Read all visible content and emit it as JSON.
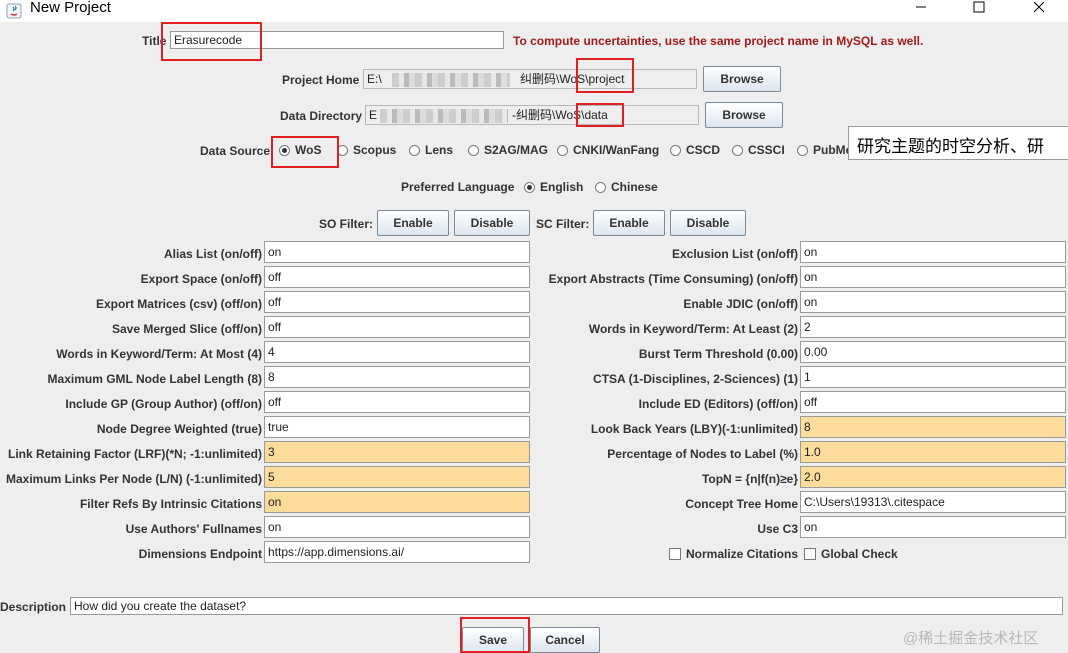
{
  "window": {
    "title": "New Project"
  },
  "title_row": {
    "label": "Title",
    "value": "Erasurecode",
    "note": "To compute uncertainties, use the same project name in MySQL as well."
  },
  "project_home": {
    "label": "Project Home",
    "prefix": "E:\\",
    "suffix": "纠删码\\WoS\\project",
    "browse": "Browse"
  },
  "data_directory": {
    "label": "Data Directory",
    "prefix": "E",
    "suffix": "-纠删码\\WoS\\data",
    "browse": "Browse"
  },
  "data_source": {
    "label": "Data Source",
    "options": [
      "WoS",
      "Scopus",
      "Lens",
      "S2AG/MAG",
      "CNKI/WanFang",
      "CSCD",
      "CSSCI",
      "PubMe"
    ],
    "selected": "WoS"
  },
  "preferred_language": {
    "label": "Preferred Language",
    "options": [
      "English",
      "Chinese"
    ],
    "selected": "English"
  },
  "so_filter": {
    "label": "SO Filter:",
    "enable": "Enable",
    "disable": "Disable"
  },
  "sc_filter": {
    "label": "SC Filter:",
    "enable": "Enable",
    "disable": "Disable"
  },
  "left_params": [
    {
      "label": "Alias List (on/off)",
      "value": "on",
      "highlight": false
    },
    {
      "label": "Export Space (on/off)",
      "value": "off",
      "highlight": false
    },
    {
      "label": "Export Matrices (csv) (off/on)",
      "value": "off",
      "highlight": false
    },
    {
      "label": "Save Merged Slice (off/on)",
      "value": "off",
      "highlight": false
    },
    {
      "label": "Words in Keyword/Term: At Most (4)",
      "value": "4",
      "highlight": false
    },
    {
      "label": "Maximum GML Node Label Length (8)",
      "value": "8",
      "highlight": false
    },
    {
      "label": "Include GP (Group Author) (off/on)",
      "value": "off",
      "highlight": false
    },
    {
      "label": "Node Degree Weighted (true)",
      "value": "true",
      "highlight": false
    },
    {
      "label": "Link Retaining Factor (LRF)(*N; -1:unlimited)",
      "value": "3",
      "highlight": true
    },
    {
      "label": "Maximum Links Per Node (L/N) (-1:unlimited)",
      "value": "5",
      "highlight": true
    },
    {
      "label": "Filter Refs By Intrinsic Citations",
      "value": "on",
      "highlight": true
    },
    {
      "label": "Use Authors' Fullnames",
      "value": "on",
      "highlight": false
    },
    {
      "label": "Dimensions Endpoint",
      "value": "https://app.dimensions.ai/",
      "highlight": false
    }
  ],
  "right_params": [
    {
      "label": "Exclusion List (on/off)",
      "value": "on",
      "highlight": false
    },
    {
      "label": "Export Abstracts (Time Consuming) (on/off)",
      "value": "on",
      "highlight": false
    },
    {
      "label": "Enable JDIC (on/off)",
      "value": "on",
      "highlight": false
    },
    {
      "label": "Words in Keyword/Term: At Least (2)",
      "value": "2",
      "highlight": false
    },
    {
      "label": "Burst Term Threshold (0.00)",
      "value": "0.00",
      "highlight": false
    },
    {
      "label": "CTSA (1-Disciplines, 2-Sciences) (1)",
      "value": "1",
      "highlight": false
    },
    {
      "label": "Include ED (Editors) (off/on)",
      "value": "off",
      "highlight": false
    },
    {
      "label": "Look Back Years (LBY)(-1:unlimited)",
      "value": "8",
      "highlight": true
    },
    {
      "label": "Percentage of Nodes to Label (%)",
      "value": "1.0",
      "highlight": true
    },
    {
      "label": "TopN = {n|f(n)≥e}",
      "value": "2.0",
      "highlight": true
    },
    {
      "label": "Concept Tree Home",
      "value": "C:\\Users\\19313\\.citespace",
      "highlight": false
    },
    {
      "label": "Use C3",
      "value": "on",
      "highlight": false
    }
  ],
  "checks": {
    "normalize": "Normalize Citations",
    "global": "Global Check"
  },
  "description": {
    "label": "Description",
    "value": "How did you create the dataset?"
  },
  "buttons": {
    "save": "Save",
    "cancel": "Cancel"
  },
  "tooltip": "研究主题的时空分析、研",
  "watermark": "@稀土掘金技术社区",
  "colors": {
    "highlight_field": "#fcdc9b",
    "note_red": "#a11a1a",
    "annotation_red": "#e02020"
  }
}
